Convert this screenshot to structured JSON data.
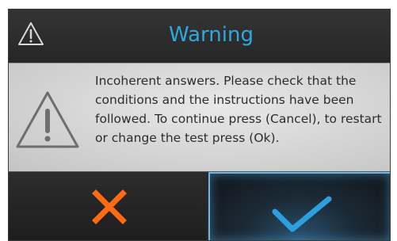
{
  "dialog": {
    "title": "Warning",
    "title_icon": "warning-triangle-icon",
    "body_icon": "warning-triangle-icon",
    "message": "Incoherent answers. Please check that the conditions and the instructions have been followed. To continue press (Cancel), to restart or change the test press (Ok).",
    "buttons": {
      "cancel": {
        "icon": "close-x-icon",
        "color": "#ff6a13"
      },
      "ok": {
        "icon": "checkmark-icon",
        "color": "#2d9fe0"
      }
    }
  },
  "colors": {
    "title_text": "#2fa8e0",
    "body_background": "#d8d8d8",
    "frame": "#2a2a2a"
  }
}
